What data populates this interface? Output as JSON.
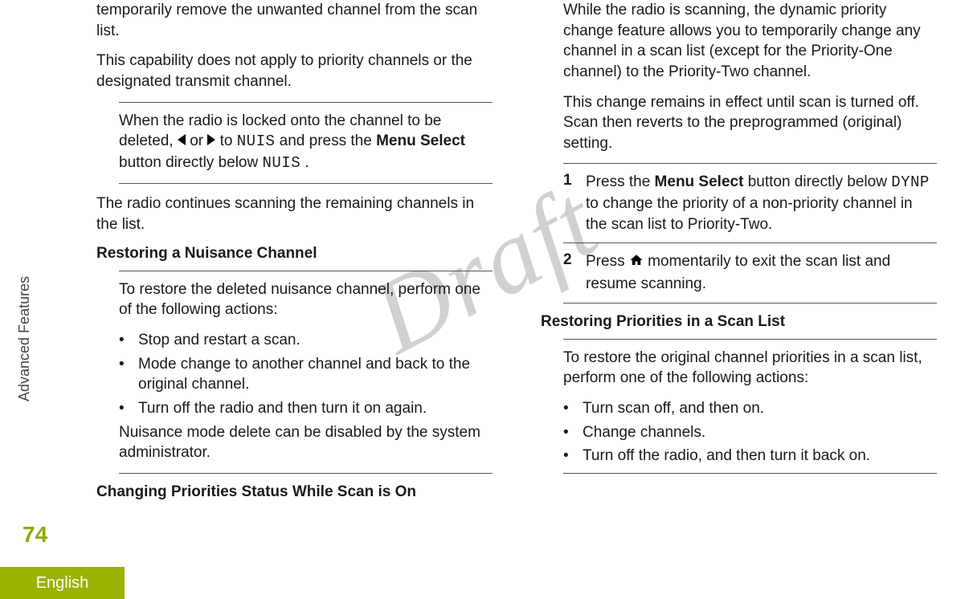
{
  "sidebar_label": "Advanced Features",
  "page_number": "74",
  "language": "English",
  "watermark": "Draft",
  "left": {
    "intro1": "temporarily remove the unwanted channel from the scan list.",
    "intro2": "This capability does not apply to priority channels or the designated transmit channel.",
    "step_a": "When the radio is locked onto the channel to be deleted, ",
    "step_b": " or ",
    "step_c": " to ",
    "nuis1": "NUIS",
    "step_d": " and press the ",
    "menu_select": "Menu Select",
    "step_e": " button directly below ",
    "nuis2": "NUIS",
    "step_f": ".",
    "after_step": "The radio continues scanning the remaining channels in the list.",
    "restore_heading": "Restoring a Nuisance Channel",
    "restore_intro": "To restore the deleted nuisance channel, perform one of the following actions:",
    "restore_bullets": [
      "Stop and restart a scan.",
      "Mode change to another channel and back to the original channel.",
      "Turn off the radio and then turn it on again."
    ],
    "restore_note": "Nuisance mode delete can be disabled by the system administrator."
  },
  "right": {
    "change_heading": "Changing Priorities Status While Scan is On",
    "change_p1": "While the radio is scanning, the dynamic priority change feature allows you to temporarily change any channel in a scan list (except for the Priority-One channel) to the Priority-Two channel.",
    "change_p2": "This change remains in effect until scan is turned off. Scan then reverts to the preprogrammed (original) setting.",
    "step1_a": "Press the ",
    "step1_ms": "Menu Select",
    "step1_b": " button directly below ",
    "dynp": "DYNP",
    "step1_c": " to change the priority of a non-priority channel in the scan list to Priority-Two.",
    "step1_num": "1",
    "step2_num": "2",
    "step2_a": "Press ",
    "step2_b": " momentarily to exit the scan list and resume scanning.",
    "restore_prio_heading": "Restoring Priorities in a Scan List",
    "restore_prio_intro": "To restore the original channel priorities in a scan list, perform one of the following actions:",
    "restore_prio_bullets": [
      "Turn scan off, and then on.",
      "Change channels.",
      "Turn off the radio, and then turn it back on."
    ]
  }
}
